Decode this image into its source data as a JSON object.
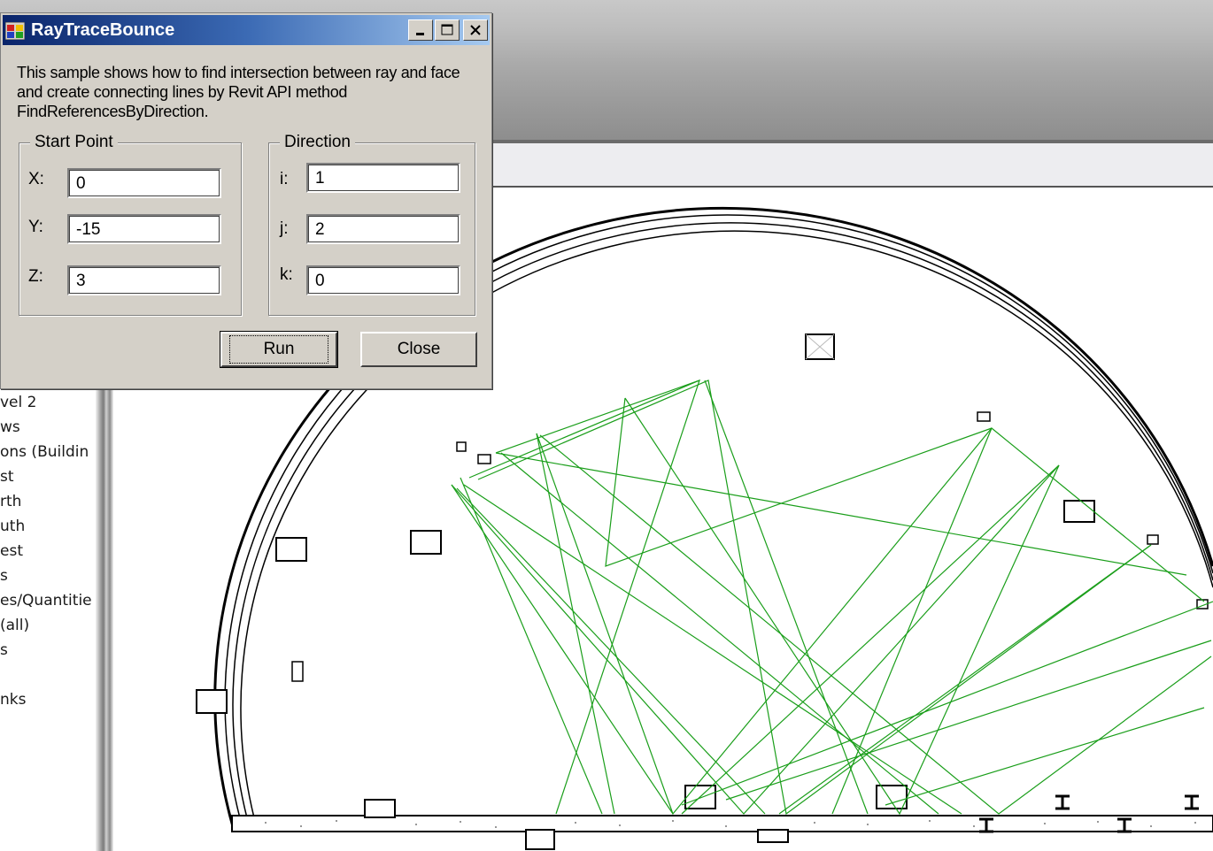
{
  "dialog": {
    "title": "RayTraceBounce",
    "description": "This sample shows how to find intersection between ray and face and create connecting lines by Revit API method FindReferencesByDirection.",
    "start_point": {
      "legend": "Start Point",
      "x_label": "X:",
      "x_value": "0",
      "y_label": "Y:",
      "y_value": "-15",
      "z_label": "Z:",
      "z_value": "3"
    },
    "direction": {
      "legend": "Direction",
      "i_label": "i:",
      "i_value": "1",
      "j_label": "j:",
      "j_value": "2",
      "k_label": "k:",
      "k_value": "0"
    },
    "run_label": "Run",
    "close_label": "Close"
  },
  "project_browser": {
    "items": [
      "vel 2",
      "ws",
      "ons (Buildin",
      "st",
      "rth",
      "uth",
      "est",
      "s",
      "es/Quantitie",
      "(all)",
      "s",
      "",
      "nks"
    ]
  },
  "colors": {
    "ray_lines": "#1a9e1a",
    "title_bar_start": "#0a246a",
    "title_bar_end": "#a6caf0",
    "dialog_face": "#d4d0c8"
  }
}
